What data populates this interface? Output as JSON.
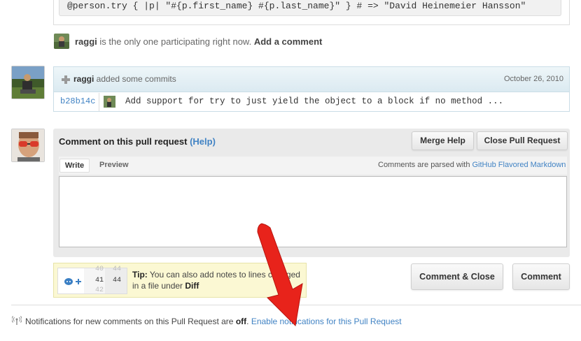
{
  "code": {
    "line": "@person.try { |p| \"#{p.first_name} #{p.last_name}\" } # => \"David Heinemeier Hansson\""
  },
  "participation": {
    "user": "raggi",
    "text": " is the only one participating right now. ",
    "add_comment": "Add a comment"
  },
  "commits": {
    "user": "raggi",
    "action": " added some commits",
    "date": "October 26, 2010",
    "sha": "b28b14c",
    "message": "Add support for try to just yield the object to a block if no method ..."
  },
  "comment_form": {
    "title": "Comment on this pull request",
    "help": "(Help)",
    "merge_help": "Merge Help",
    "close_pr": "Close Pull Request",
    "tab_write": "Write",
    "tab_preview": "Preview",
    "parse_prefix": "Comments are parsed with ",
    "parse_link": "GitHub Flavored Markdown",
    "textarea_value": ""
  },
  "tip": {
    "label": "Tip:",
    "text": " You can also add notes to lines changed in a file under ",
    "link": "Diff",
    "line_numbers": [
      "40",
      "41",
      "42"
    ],
    "line_numbers_right": [
      "44",
      "44"
    ]
  },
  "actions": {
    "comment_close": "Comment & Close",
    "comment": "Comment"
  },
  "notifications": {
    "prefix": "Notifications for new comments on this Pull Request are ",
    "state": "off",
    "suffix": ". ",
    "link": "Enable notifications for this Pull Request"
  },
  "colors": {
    "link": "#4183c4",
    "arrow": "#e8231b",
    "tip_bg": "#fbf8d3"
  }
}
